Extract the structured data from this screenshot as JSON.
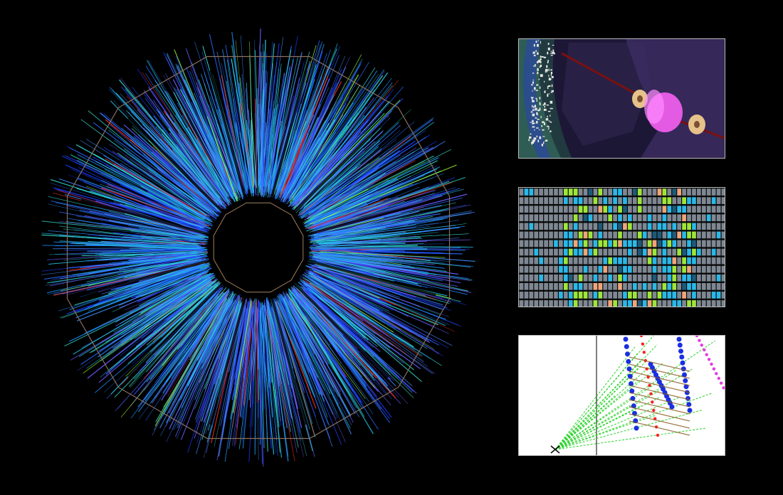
{
  "scene": {
    "background": "#000000",
    "event_display": {
      "shape": "dodecagon",
      "outline_color": "#8a7060",
      "track_colors": [
        "#1b3cff",
        "#2a6bff",
        "#22c7e8",
        "#33e0d0",
        "#3f8cff",
        "#1e90ff",
        "#6a5cff",
        "#ff2a1a",
        "#9dff3a"
      ],
      "inner_hole_color": "#000000"
    },
    "panels": [
      {
        "id": "detector-closeup",
        "palette": [
          "#2f5c55",
          "#1d1736",
          "#3d2d63",
          "#ee66ee",
          "#e6c18a",
          "#7a1010"
        ]
      },
      {
        "id": "hit-heatmap",
        "palette": [
          "#7e8792",
          "#2a3038",
          "#2ab8e8",
          "#9ee63a",
          "#f0a57a",
          "#1d5a7a"
        ]
      },
      {
        "id": "track-fit",
        "palette": [
          "#ffffff",
          "#1b2fe0",
          "#ff1f1f",
          "#2ad32a",
          "#e33ae3",
          "#8a5a20",
          "#000000"
        ]
      }
    ]
  }
}
